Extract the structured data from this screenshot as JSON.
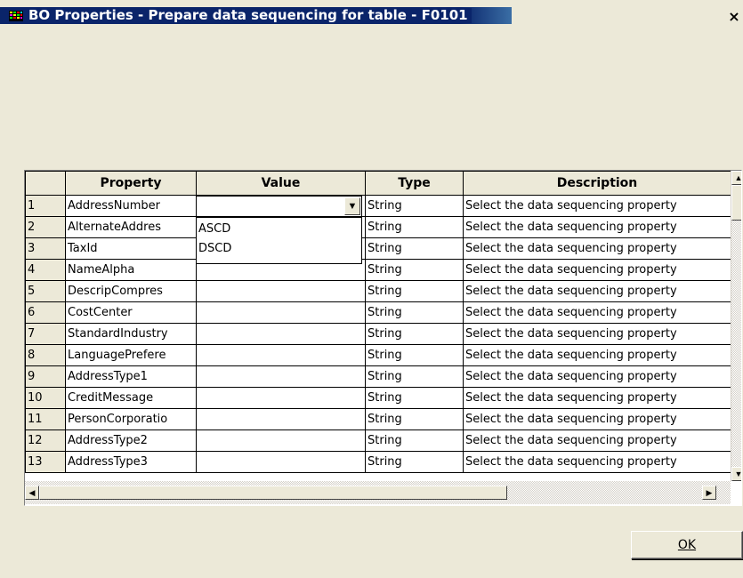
{
  "window": {
    "title": "BO Properties - Prepare data sequencing for table - F0101",
    "close_glyph": "×"
  },
  "grid": {
    "columns": [
      "",
      "Property",
      "Value",
      "Type",
      "Description"
    ],
    "rows": [
      {
        "num": "1",
        "property": "AddressNumber",
        "value": "",
        "type": "String",
        "description": "Select the data sequencing property"
      },
      {
        "num": "2",
        "property": "AlternateAddres",
        "value": "",
        "type": "String",
        "description": "Select the data sequencing property"
      },
      {
        "num": "3",
        "property": "TaxId",
        "value": "",
        "type": "String",
        "description": "Select the data sequencing property"
      },
      {
        "num": "4",
        "property": "NameAlpha",
        "value": "",
        "type": "String",
        "description": "Select the data sequencing property"
      },
      {
        "num": "5",
        "property": "DescripCompres",
        "value": "",
        "type": "String",
        "description": "Select the data sequencing property"
      },
      {
        "num": "6",
        "property": "CostCenter",
        "value": "",
        "type": "String",
        "description": "Select the data sequencing property"
      },
      {
        "num": "7",
        "property": "StandardIndustry",
        "value": "",
        "type": "String",
        "description": "Select the data sequencing property"
      },
      {
        "num": "8",
        "property": "LanguagePrefere",
        "value": "",
        "type": "String",
        "description": "Select the data sequencing property"
      },
      {
        "num": "9",
        "property": "AddressType1",
        "value": "",
        "type": "String",
        "description": "Select the data sequencing property"
      },
      {
        "num": "10",
        "property": "CreditMessage",
        "value": "",
        "type": "String",
        "description": "Select the data sequencing property"
      },
      {
        "num": "11",
        "property": "PersonCorporatio",
        "value": "",
        "type": "String",
        "description": "Select the data sequencing property"
      },
      {
        "num": "12",
        "property": "AddressType2",
        "value": "",
        "type": "String",
        "description": "Select the data sequencing property"
      },
      {
        "num": "13",
        "property": "AddressType3",
        "value": "",
        "type": "String",
        "description": "Select the data sequencing property"
      }
    ],
    "dropdown_options": [
      "ASCD",
      "DSCD"
    ]
  },
  "buttons": {
    "ok_label": "OK"
  },
  "icons": {
    "app": "app-grid-icon",
    "scroll_up": "scroll-up-arrow-icon",
    "scroll_down": "scroll-down-arrow-icon",
    "scroll_left": "scroll-left-arrow-icon",
    "scroll_right": "scroll-right-arrow-icon",
    "combo_arrow": "dropdown-arrow-icon"
  },
  "colors": {
    "title_bg": "#0a246a",
    "dialog_bg": "#ece9d8"
  }
}
